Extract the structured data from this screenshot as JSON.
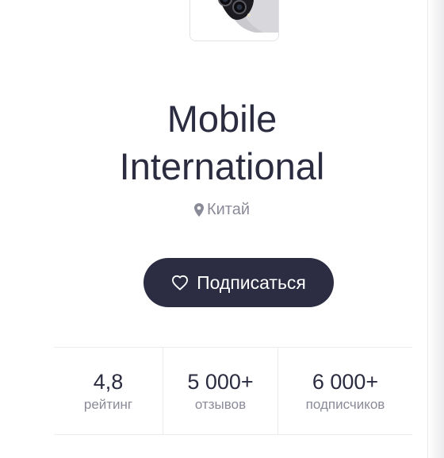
{
  "store": {
    "name_line1": "Mobile",
    "name_line2": "International",
    "location": "Китай",
    "location_icon": "map-pin-icon",
    "logo_image": "phone-camera-image"
  },
  "actions": {
    "subscribe_label": "Подписаться",
    "subscribe_icon": "heart-outline-icon"
  },
  "stats": [
    {
      "value": "4,8",
      "label": "рейтинг"
    },
    {
      "value": "5 000+",
      "label": "отзывов"
    },
    {
      "value": "6 000+",
      "label": "подписчиков"
    }
  ],
  "colors": {
    "primary_text": "#2b2c40",
    "secondary_text": "#8a8b98",
    "button_bg": "#2c2d42",
    "button_text": "#ffffff",
    "divider": "#ececef"
  }
}
